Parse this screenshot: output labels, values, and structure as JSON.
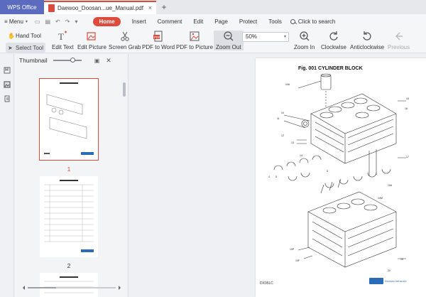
{
  "titlebar": {
    "app_tab": "WPS Office",
    "doc_tab": "Daewoo_Doosan...ue_Manual.pdf",
    "close": "×",
    "new_tab": "+"
  },
  "menubar": {
    "menu": "≡ Menu",
    "items": [
      "Home",
      "Insert",
      "Comment",
      "Edit",
      "Page",
      "Protect",
      "Tools"
    ],
    "active": "Home",
    "search": "Click to search"
  },
  "toolbar": {
    "hand_tool": "Hand Tool",
    "select_tool": "Select Tool",
    "edit_text": "Edit Text",
    "edit_picture": "Edit Picture",
    "screen_grab": "Screen Grab",
    "pdf_to_word": "PDF to Word",
    "pdf_to_picture": "PDF to Picture",
    "zoom_out": "Zoom Out",
    "zoom_value": "50%",
    "zoom_in": "Zoom In",
    "clockwise": "Clockwise",
    "anticlockwise": "Anticlockwise",
    "previous": "Previous"
  },
  "thumbnail_panel": {
    "title": "Thumbnail",
    "slider_level": 0.6,
    "pages": [
      {
        "number": "1"
      },
      {
        "number": "2"
      }
    ]
  },
  "document": {
    "figure_title": "Fig. 001 CYLINDER BLOCK",
    "footer_code": "DX95LC",
    "brand_text": "Doosan Infracore"
  },
  "colors": {
    "accent_red": "#e04a3c",
    "app_tab_blue": "#5b6cc0",
    "brand_blue": "#2a6cb7"
  }
}
